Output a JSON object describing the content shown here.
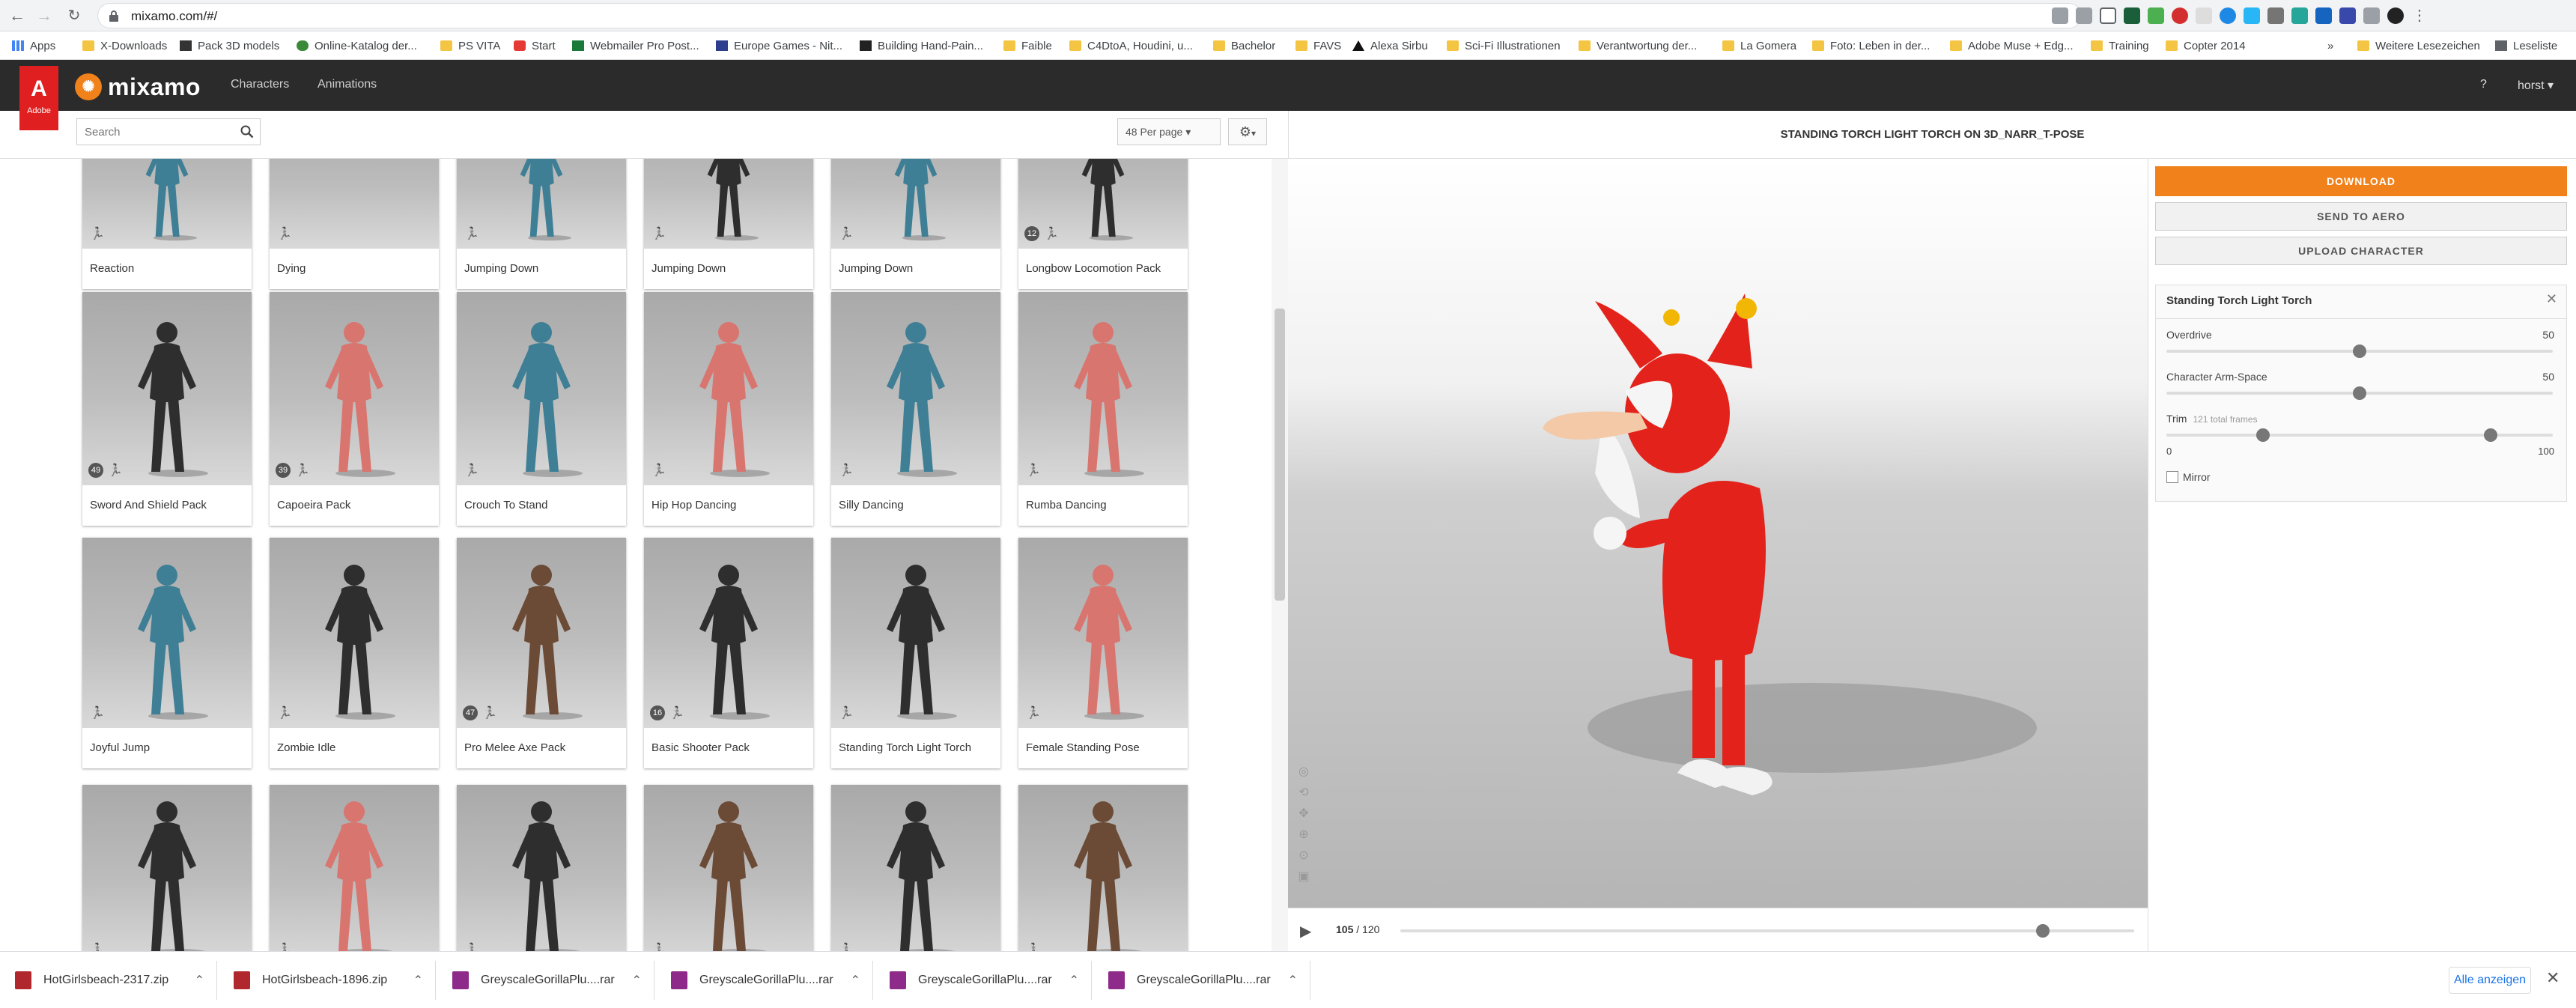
{
  "browser": {
    "url": "mixamo.com/#/",
    "bookmarks": [
      {
        "label": "Apps"
      },
      {
        "label": "X-Downloads"
      },
      {
        "label": "Pack 3D models"
      },
      {
        "label": "Online-Katalog der..."
      },
      {
        "label": "PS VITA"
      },
      {
        "label": "Start"
      },
      {
        "label": "Webmailer Pro Post..."
      },
      {
        "label": "Europe Games - Nit..."
      },
      {
        "label": "Building Hand-Pain..."
      },
      {
        "label": "Faible"
      },
      {
        "label": "C4DtoA, Houdini, u..."
      },
      {
        "label": "Bachelor"
      },
      {
        "label": "FAVS"
      },
      {
        "label": "Alexa Sirbu"
      },
      {
        "label": "Sci-Fi Illustrationen"
      },
      {
        "label": "Verantwortung der..."
      },
      {
        "label": "La Gomera"
      },
      {
        "label": "Foto: Leben in der..."
      },
      {
        "label": "Adobe Muse + Edg..."
      },
      {
        "label": "Training"
      },
      {
        "label": "Copter 2014"
      },
      {
        "label": "»"
      },
      {
        "label": "Weitere Lesezeichen"
      },
      {
        "label": "Leseliste"
      }
    ]
  },
  "app": {
    "adobe_label": "Adobe",
    "brand": "mixamo",
    "nav": [
      "Characters",
      "Animations"
    ],
    "help": "?",
    "user": "horst ▾",
    "accent": "#f0811b"
  },
  "toolbar": {
    "search_placeholder": "Search",
    "per_page": "48 Per page",
    "preview_title": "STANDING TORCH LIGHT TORCH ON 3D_NARR_T-POSE"
  },
  "cards": [
    {
      "label": "Reaction",
      "pack": "",
      "color": "teal"
    },
    {
      "label": "Dying",
      "pack": "",
      "color": "none"
    },
    {
      "label": "Jumping Down",
      "pack": "",
      "color": "teal"
    },
    {
      "label": "Jumping Down",
      "pack": "",
      "color": "dark"
    },
    {
      "label": "Jumping Down",
      "pack": "",
      "color": "teal"
    },
    {
      "label": "Longbow Locomotion Pack",
      "pack": "12",
      "color": "dark"
    },
    {
      "label": "Sword And Shield Pack",
      "pack": "49",
      "color": "dark"
    },
    {
      "label": "Capoeira Pack",
      "pack": "39",
      "color": "pink"
    },
    {
      "label": "Crouch To Stand",
      "pack": "",
      "color": "teal"
    },
    {
      "label": "Hip Hop Dancing",
      "pack": "",
      "color": "pink"
    },
    {
      "label": "Silly Dancing",
      "pack": "",
      "color": "teal"
    },
    {
      "label": "Rumba Dancing",
      "pack": "",
      "color": "pink"
    },
    {
      "label": "Joyful Jump",
      "pack": "",
      "color": "teal"
    },
    {
      "label": "Zombie Idle",
      "pack": "",
      "color": "dark"
    },
    {
      "label": "Pro Melee Axe Pack",
      "pack": "47",
      "color": "brown"
    },
    {
      "label": "Basic Shooter Pack",
      "pack": "16",
      "color": "dark"
    },
    {
      "label": "Standing Torch Light Torch",
      "pack": "",
      "color": "dark"
    },
    {
      "label": "Female Standing Pose",
      "pack": "",
      "color": "pink"
    },
    {
      "label": "",
      "pack": "",
      "color": "dark"
    },
    {
      "label": "",
      "pack": "",
      "color": "pink"
    },
    {
      "label": "",
      "pack": "",
      "color": "dark"
    },
    {
      "label": "",
      "pack": "",
      "color": "brown"
    },
    {
      "label": "",
      "pack": "",
      "color": "dark"
    },
    {
      "label": "",
      "pack": "",
      "color": "brown"
    }
  ],
  "player": {
    "frame": "105",
    "total": " / 120",
    "progress": 0.875
  },
  "panel": {
    "download": "DOWNLOAD",
    "send_to_aero": "SEND TO AERO",
    "upload_character": "UPLOAD CHARACTER",
    "settings_title": "Standing Torch Light Torch",
    "close": "✕",
    "overdrive_label": "Overdrive",
    "overdrive_value": "50",
    "overdrive_level": 0.5,
    "armspace_label": "Character Arm-Space",
    "armspace_value": "50",
    "armspace_level": 0.5,
    "trim_label": "Trim",
    "trim_note": "121 total frames",
    "trim_min": "0",
    "trim_max": "100",
    "trim_start": 0.25,
    "trim_end": 0.84,
    "mirror_label": "Mirror"
  },
  "downloads": {
    "items": [
      {
        "name": "HotGirlsbeach-2317.zip"
      },
      {
        "name": "HotGirlsbeach-1896.zip"
      },
      {
        "name": "GreyscaleGorillaPlu....rar"
      },
      {
        "name": "GreyscaleGorillaPlu....rar"
      },
      {
        "name": "GreyscaleGorillaPlu....rar"
      },
      {
        "name": "GreyscaleGorillaPlu....rar"
      }
    ],
    "show_all": "Alle anzeigen",
    "close": "✕"
  }
}
